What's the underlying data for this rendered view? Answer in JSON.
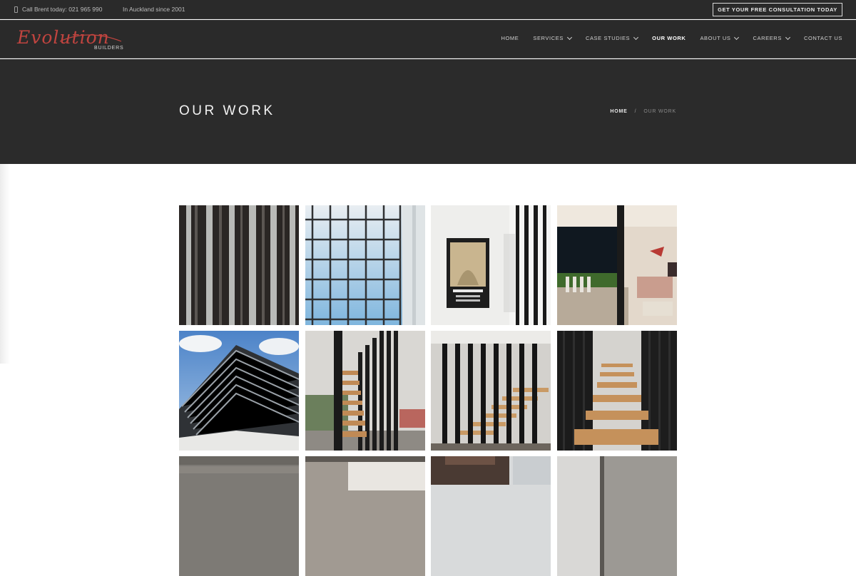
{
  "topbar": {
    "phone_text": "Call Brent today: 021 965 990",
    "since_text": "In Auckland since 2001",
    "cta_label": "GET YOUR FREE CONSULTATION TODAY"
  },
  "logo": {
    "script": "Evolution",
    "sub": "BUILDERS"
  },
  "nav": {
    "items": [
      {
        "label": "HOME"
      },
      {
        "label": "SERVICES"
      },
      {
        "label": "CASE STUDIES"
      },
      {
        "label": "OUR WORK"
      },
      {
        "label": "ABOUT US"
      },
      {
        "label": "CAREERS"
      },
      {
        "label": "CONTACT US"
      }
    ]
  },
  "hero": {
    "title": "OUR WORK",
    "breadcrumb_home": "HOME",
    "breadcrumb_sep": "/",
    "breadcrumb_current": "OUR WORK"
  },
  "gallery": {
    "photos": [
      "vertical-slats-photo",
      "textured-glass-window-photo",
      "poster-and-screen-photo",
      "living-room-night-photo",
      "louvred-facade-photo",
      "floating-stairs-photo",
      "stairs-behind-slats-photo",
      "timber-stairs-photo",
      "concrete-wall-photo",
      "interior-room-photo",
      "outdoor-structure-photo",
      "concrete-corner-photo"
    ]
  },
  "colors": {
    "header_bg": "#2a2a2a",
    "hero_bg": "#2b2b2b",
    "logo_red": "#c0443f"
  }
}
